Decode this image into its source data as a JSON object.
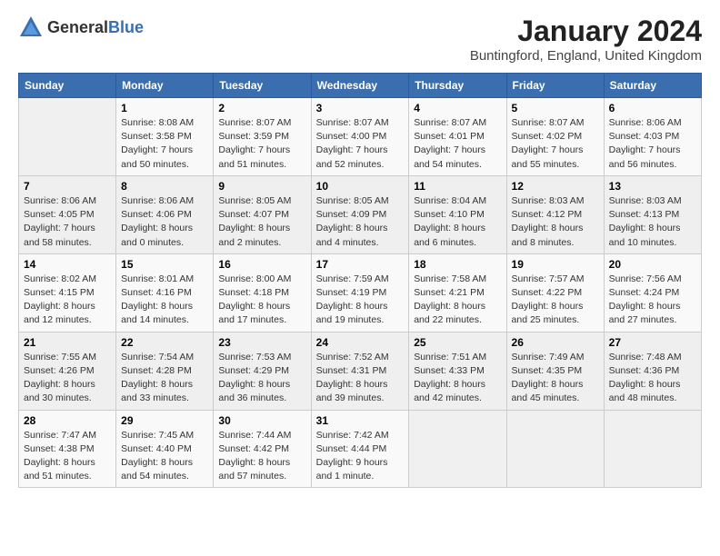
{
  "logo": {
    "text_general": "General",
    "text_blue": "Blue"
  },
  "title": "January 2024",
  "location": "Buntingford, England, United Kingdom",
  "days_of_week": [
    "Sunday",
    "Monday",
    "Tuesday",
    "Wednesday",
    "Thursday",
    "Friday",
    "Saturday"
  ],
  "weeks": [
    [
      {
        "day": "",
        "info": ""
      },
      {
        "day": "1",
        "info": "Sunrise: 8:08 AM\nSunset: 3:58 PM\nDaylight: 7 hours\nand 50 minutes."
      },
      {
        "day": "2",
        "info": "Sunrise: 8:07 AM\nSunset: 3:59 PM\nDaylight: 7 hours\nand 51 minutes."
      },
      {
        "day": "3",
        "info": "Sunrise: 8:07 AM\nSunset: 4:00 PM\nDaylight: 7 hours\nand 52 minutes."
      },
      {
        "day": "4",
        "info": "Sunrise: 8:07 AM\nSunset: 4:01 PM\nDaylight: 7 hours\nand 54 minutes."
      },
      {
        "day": "5",
        "info": "Sunrise: 8:07 AM\nSunset: 4:02 PM\nDaylight: 7 hours\nand 55 minutes."
      },
      {
        "day": "6",
        "info": "Sunrise: 8:06 AM\nSunset: 4:03 PM\nDaylight: 7 hours\nand 56 minutes."
      }
    ],
    [
      {
        "day": "7",
        "info": "Sunrise: 8:06 AM\nSunset: 4:05 PM\nDaylight: 7 hours\nand 58 minutes."
      },
      {
        "day": "8",
        "info": "Sunrise: 8:06 AM\nSunset: 4:06 PM\nDaylight: 8 hours\nand 0 minutes."
      },
      {
        "day": "9",
        "info": "Sunrise: 8:05 AM\nSunset: 4:07 PM\nDaylight: 8 hours\nand 2 minutes."
      },
      {
        "day": "10",
        "info": "Sunrise: 8:05 AM\nSunset: 4:09 PM\nDaylight: 8 hours\nand 4 minutes."
      },
      {
        "day": "11",
        "info": "Sunrise: 8:04 AM\nSunset: 4:10 PM\nDaylight: 8 hours\nand 6 minutes."
      },
      {
        "day": "12",
        "info": "Sunrise: 8:03 AM\nSunset: 4:12 PM\nDaylight: 8 hours\nand 8 minutes."
      },
      {
        "day": "13",
        "info": "Sunrise: 8:03 AM\nSunset: 4:13 PM\nDaylight: 8 hours\nand 10 minutes."
      }
    ],
    [
      {
        "day": "14",
        "info": "Sunrise: 8:02 AM\nSunset: 4:15 PM\nDaylight: 8 hours\nand 12 minutes."
      },
      {
        "day": "15",
        "info": "Sunrise: 8:01 AM\nSunset: 4:16 PM\nDaylight: 8 hours\nand 14 minutes."
      },
      {
        "day": "16",
        "info": "Sunrise: 8:00 AM\nSunset: 4:18 PM\nDaylight: 8 hours\nand 17 minutes."
      },
      {
        "day": "17",
        "info": "Sunrise: 7:59 AM\nSunset: 4:19 PM\nDaylight: 8 hours\nand 19 minutes."
      },
      {
        "day": "18",
        "info": "Sunrise: 7:58 AM\nSunset: 4:21 PM\nDaylight: 8 hours\nand 22 minutes."
      },
      {
        "day": "19",
        "info": "Sunrise: 7:57 AM\nSunset: 4:22 PM\nDaylight: 8 hours\nand 25 minutes."
      },
      {
        "day": "20",
        "info": "Sunrise: 7:56 AM\nSunset: 4:24 PM\nDaylight: 8 hours\nand 27 minutes."
      }
    ],
    [
      {
        "day": "21",
        "info": "Sunrise: 7:55 AM\nSunset: 4:26 PM\nDaylight: 8 hours\nand 30 minutes."
      },
      {
        "day": "22",
        "info": "Sunrise: 7:54 AM\nSunset: 4:28 PM\nDaylight: 8 hours\nand 33 minutes."
      },
      {
        "day": "23",
        "info": "Sunrise: 7:53 AM\nSunset: 4:29 PM\nDaylight: 8 hours\nand 36 minutes."
      },
      {
        "day": "24",
        "info": "Sunrise: 7:52 AM\nSunset: 4:31 PM\nDaylight: 8 hours\nand 39 minutes."
      },
      {
        "day": "25",
        "info": "Sunrise: 7:51 AM\nSunset: 4:33 PM\nDaylight: 8 hours\nand 42 minutes."
      },
      {
        "day": "26",
        "info": "Sunrise: 7:49 AM\nSunset: 4:35 PM\nDaylight: 8 hours\nand 45 minutes."
      },
      {
        "day": "27",
        "info": "Sunrise: 7:48 AM\nSunset: 4:36 PM\nDaylight: 8 hours\nand 48 minutes."
      }
    ],
    [
      {
        "day": "28",
        "info": "Sunrise: 7:47 AM\nSunset: 4:38 PM\nDaylight: 8 hours\nand 51 minutes."
      },
      {
        "day": "29",
        "info": "Sunrise: 7:45 AM\nSunset: 4:40 PM\nDaylight: 8 hours\nand 54 minutes."
      },
      {
        "day": "30",
        "info": "Sunrise: 7:44 AM\nSunset: 4:42 PM\nDaylight: 8 hours\nand 57 minutes."
      },
      {
        "day": "31",
        "info": "Sunrise: 7:42 AM\nSunset: 4:44 PM\nDaylight: 9 hours\nand 1 minute."
      },
      {
        "day": "",
        "info": ""
      },
      {
        "day": "",
        "info": ""
      },
      {
        "day": "",
        "info": ""
      }
    ]
  ]
}
